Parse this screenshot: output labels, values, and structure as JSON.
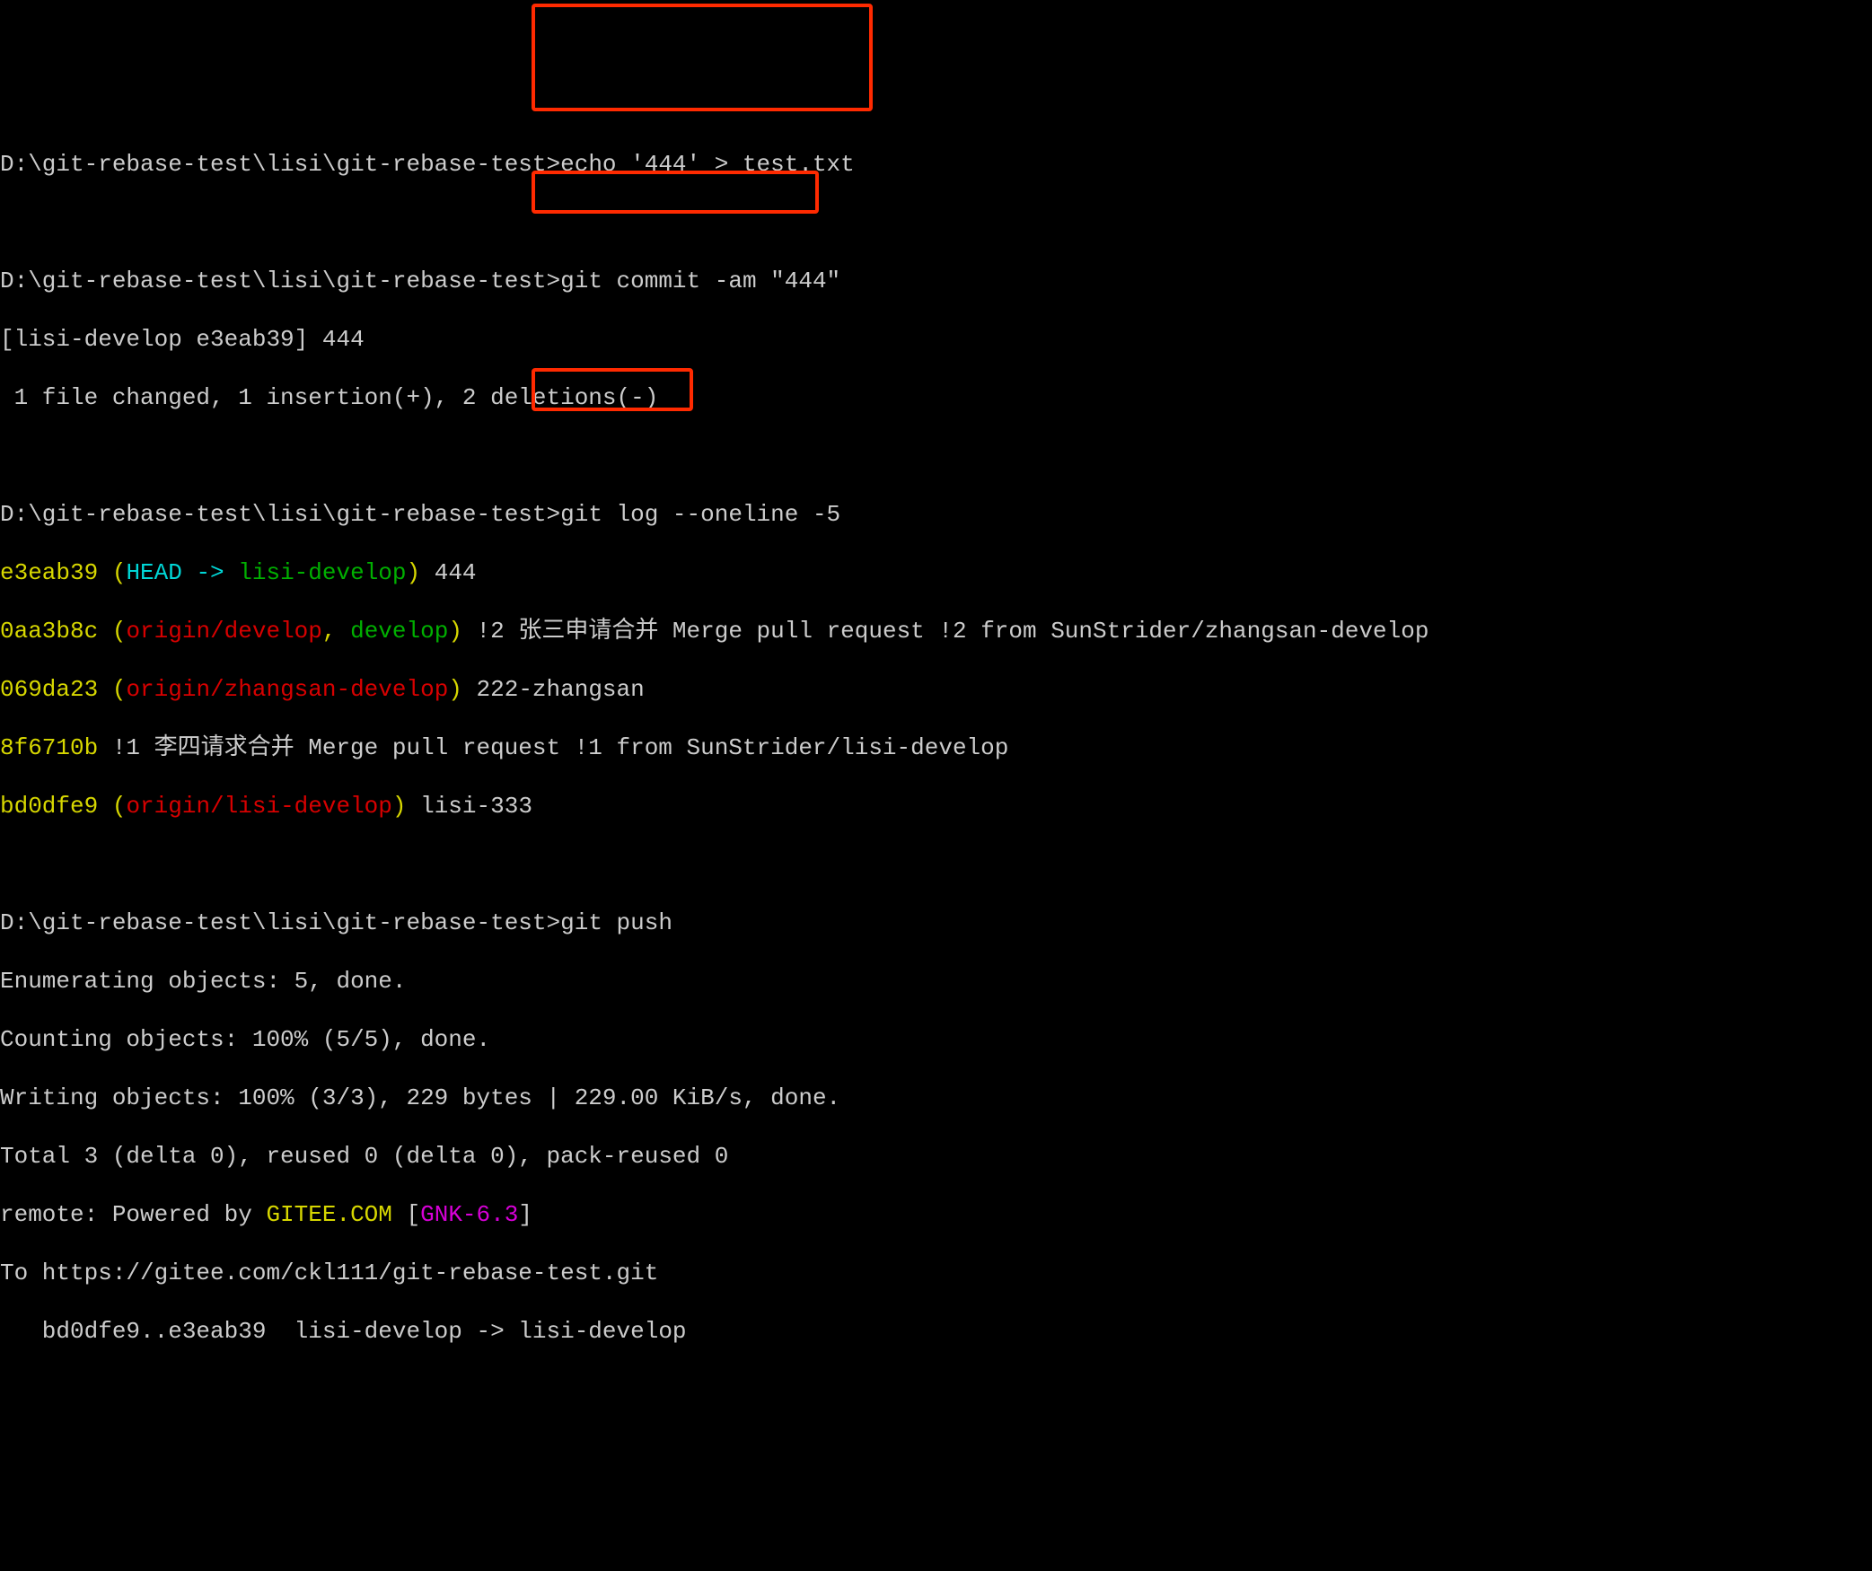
{
  "prompts": {
    "p1": "D:\\git-rebase-test\\lisi\\git-rebase-test>",
    "p2": "D:\\git-rebase-test\\lisi\\git-rebase-test>",
    "p3": "D:\\git-rebase-test\\lisi\\git-rebase-test>",
    "p4": "D:\\git-rebase-test\\lisi\\git-rebase-test>"
  },
  "cmds": {
    "c1": "echo '444' > test.txt",
    "c2": "git commit -am \"444\"",
    "c3": "git log --oneline -5",
    "c4": "git push"
  },
  "commit_output": {
    "l1": "[lisi-develop e3eab39] 444",
    "l2": " 1 file changed, 1 insertion(+), 2 deletions(-)"
  },
  "log": {
    "r1": {
      "hash": "e3eab39",
      "lparen": " (",
      "head": "HEAD -> ",
      "branch": "lisi-develop",
      "rparen": ")",
      "msg": " 444"
    },
    "r2": {
      "hash": "0aa3b8c",
      "lparen": " (",
      "remote": "origin/develop",
      "comma": ", ",
      "local": "develop",
      "rparen": ")",
      "msg": " !2 张三申请合并 Merge pull request !2 from SunStrider/zhangsan-develop"
    },
    "r3": {
      "hash": "069da23",
      "lparen": " (",
      "remote": "origin/zhangsan-develop",
      "rparen": ")",
      "msg": " 222-zhangsan"
    },
    "r4": {
      "hash": "8f6710b",
      "msg": " !1 李四请求合并 Merge pull request !1 from SunStrider/lisi-develop"
    },
    "r5": {
      "hash": "bd0dfe9",
      "lparen": " (",
      "remote": "origin/lisi-develop",
      "rparen": ")",
      "msg": " lisi-333"
    }
  },
  "push": {
    "l1": "Enumerating objects: 5, done.",
    "l2": "Counting objects: 100% (5/5), done.",
    "l3": "Writing objects: 100% (3/3), 229 bytes | 229.00 KiB/s, done.",
    "l4": "Total 3 (delta 0), reused 0 (delta 0), pack-reused 0",
    "remote_pre": "remote: Powered by ",
    "remote_gitee": "GITEE.COM",
    "remote_mid": " [",
    "remote_gnk": "GNK-6.3",
    "remote_post": "]",
    "l6": "To https://gitee.com/ckl111/git-rebase-test.git",
    "l7": "   bd0dfe9..e3eab39  lisi-develop -> lisi-develop"
  }
}
